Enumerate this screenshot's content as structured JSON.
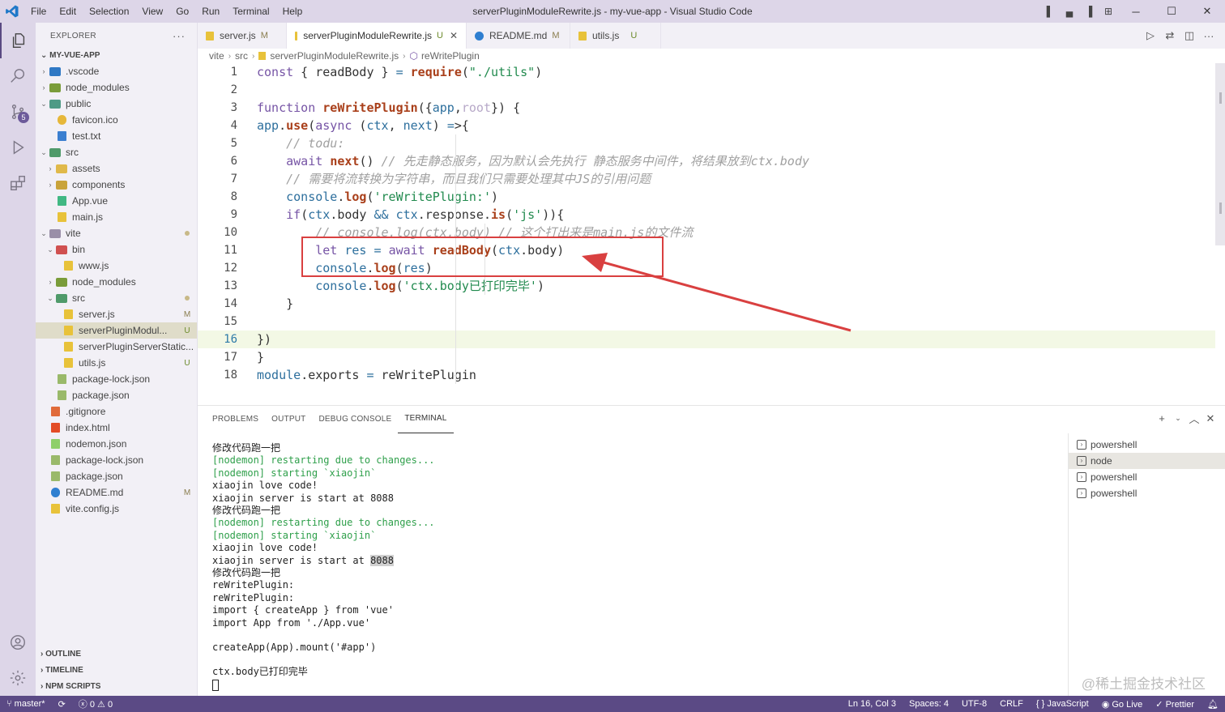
{
  "window": {
    "menu": [
      "File",
      "Edit",
      "Selection",
      "View",
      "Go",
      "Run",
      "Terminal",
      "Help"
    ],
    "title": "serverPluginModuleRewrite.js - my-vue-app - Visual Studio Code"
  },
  "activity": {
    "scm_badge": "5"
  },
  "explorer": {
    "header": "EXPLORER",
    "more": "···",
    "root": "MY-VUE-APP",
    "items": [
      {
        "name": ".vscode",
        "kind": "folder",
        "chev": "›",
        "mark": ""
      },
      {
        "name": "node_modules",
        "kind": "folder",
        "chev": "›",
        "mark": ""
      },
      {
        "name": "public",
        "kind": "folder",
        "chev": "⌄",
        "mark": ""
      },
      {
        "name": "favicon.ico",
        "kind": "file",
        "chev": "",
        "mark": ""
      },
      {
        "name": "test.txt",
        "kind": "file",
        "chev": "",
        "mark": ""
      },
      {
        "name": "src",
        "kind": "folder",
        "chev": "⌄",
        "mark": ""
      },
      {
        "name": "assets",
        "kind": "folder",
        "chev": "›",
        "mark": ""
      },
      {
        "name": "components",
        "kind": "folder",
        "chev": "›",
        "mark": ""
      },
      {
        "name": "App.vue",
        "kind": "file",
        "chev": "",
        "mark": ""
      },
      {
        "name": "main.js",
        "kind": "file",
        "chev": "",
        "mark": ""
      },
      {
        "name": "vite",
        "kind": "folder",
        "chev": "⌄",
        "mark": ""
      },
      {
        "name": "bin",
        "kind": "folder",
        "chev": "⌄",
        "mark": ""
      },
      {
        "name": "www.js",
        "kind": "file",
        "chev": "",
        "mark": ""
      },
      {
        "name": "node_modules",
        "kind": "folder",
        "chev": "›",
        "mark": ""
      },
      {
        "name": "src",
        "kind": "folder",
        "chev": "⌄",
        "mark": ""
      },
      {
        "name": "server.js",
        "kind": "file",
        "chev": "",
        "mark": "M"
      },
      {
        "name": "serverPluginModul...",
        "kind": "file",
        "chev": "",
        "mark": "U"
      },
      {
        "name": "serverPluginServerStatic...",
        "kind": "file",
        "chev": "",
        "mark": ""
      },
      {
        "name": "utils.js",
        "kind": "file",
        "chev": "",
        "mark": "U"
      },
      {
        "name": "package-lock.json",
        "kind": "file",
        "chev": "",
        "mark": ""
      },
      {
        "name": "package.json",
        "kind": "file",
        "chev": "",
        "mark": ""
      },
      {
        "name": ".gitignore",
        "kind": "file",
        "chev": "",
        "mark": ""
      },
      {
        "name": "index.html",
        "kind": "file",
        "chev": "",
        "mark": ""
      },
      {
        "name": "nodemon.json",
        "kind": "file",
        "chev": "",
        "mark": ""
      },
      {
        "name": "package-lock.json",
        "kind": "file",
        "chev": "",
        "mark": ""
      },
      {
        "name": "package.json",
        "kind": "file",
        "chev": "",
        "mark": ""
      },
      {
        "name": "README.md",
        "kind": "file",
        "chev": "",
        "mark": "M"
      },
      {
        "name": "vite.config.js",
        "kind": "file",
        "chev": "",
        "mark": ""
      }
    ],
    "sections": [
      "OUTLINE",
      "TIMELINE",
      "NPM SCRIPTS"
    ]
  },
  "tabs": [
    {
      "label": "server.js",
      "mark": "M",
      "close": ""
    },
    {
      "label": "serverPluginModuleRewrite.js",
      "mark": "U",
      "close": "✕"
    },
    {
      "label": "README.md",
      "mark": "M",
      "close": ""
    },
    {
      "label": "utils.js",
      "mark": "U",
      "close": ""
    }
  ],
  "breadcrumb": [
    "vite",
    "src",
    "serverPluginModuleRewrite.js",
    "reWritePlugin"
  ],
  "code": {
    "current_line": 16,
    "lines": [
      "const { readBody } = require(\"./utils\")",
      "",
      "function reWritePlugin({app,root}) {",
      "app.use(async (ctx, next) =>{",
      "    // todu:",
      "    await next() // 先走静态服务，因为默认会先执行 静态服务中间件，将结果放到ctx.body",
      "    // 需要将流转换为字符串，而且我们只需要处理其中JS的引用问题",
      "    console.log('reWritePlugin:')",
      "    if(ctx.body && ctx.response.is('js')){",
      "        // console.log(ctx.body) // 这个打出来是main.js的文件流",
      "        let res = await readBody(ctx.body)",
      "        console.log(res)",
      "        console.log('ctx.body已打印完毕')",
      "    }",
      "",
      "})",
      "}",
      "module.exports = reWritePlugin"
    ]
  },
  "panel": {
    "tabs": [
      "PROBLEMS",
      "OUTPUT",
      "DEBUG CONSOLE",
      "TERMINAL"
    ],
    "active_tab": "TERMINAL",
    "terminal_lines": [
      "修改代码跑一把",
      "[nodemon] restarting due to changes...",
      "[nodemon] starting `xiaojin`",
      "xiaojin love code!",
      "xiaojin server is start at 8088",
      "修改代码跑一把",
      "[nodemon] restarting due to changes...",
      "[nodemon] starting `xiaojin`",
      "xiaojin love code!",
      "xiaojin server is start at ",
      "修改代码跑一把",
      "reWritePlugin:",
      "reWritePlugin:",
      "import { createApp } from 'vue'",
      "import App from './App.vue'",
      "",
      "createApp(App).mount('#app')",
      "",
      "ctx.body已打印完毕"
    ],
    "highlight_port": "8088",
    "terminals": [
      "powershell",
      "node",
      "powershell",
      "powershell"
    ],
    "selected_terminal": 1,
    "watermark": "@稀土掘金技术社区"
  },
  "status": {
    "branch": "master*",
    "errors": "0",
    "warnings": "0",
    "position": "Ln 16, Col 3",
    "spaces": "Spaces: 4",
    "encoding": "UTF-8",
    "eol": "CRLF",
    "language": "JavaScript",
    "golive": "Go Live",
    "prettier": "Prettier"
  },
  "colors": {
    "activity_bg": "#ddd6e8",
    "status_bg": "#5b4a85",
    "annotation_red": "#d94040",
    "selected_row": "#dfdcc9",
    "current_line": "#f3f8e5"
  }
}
